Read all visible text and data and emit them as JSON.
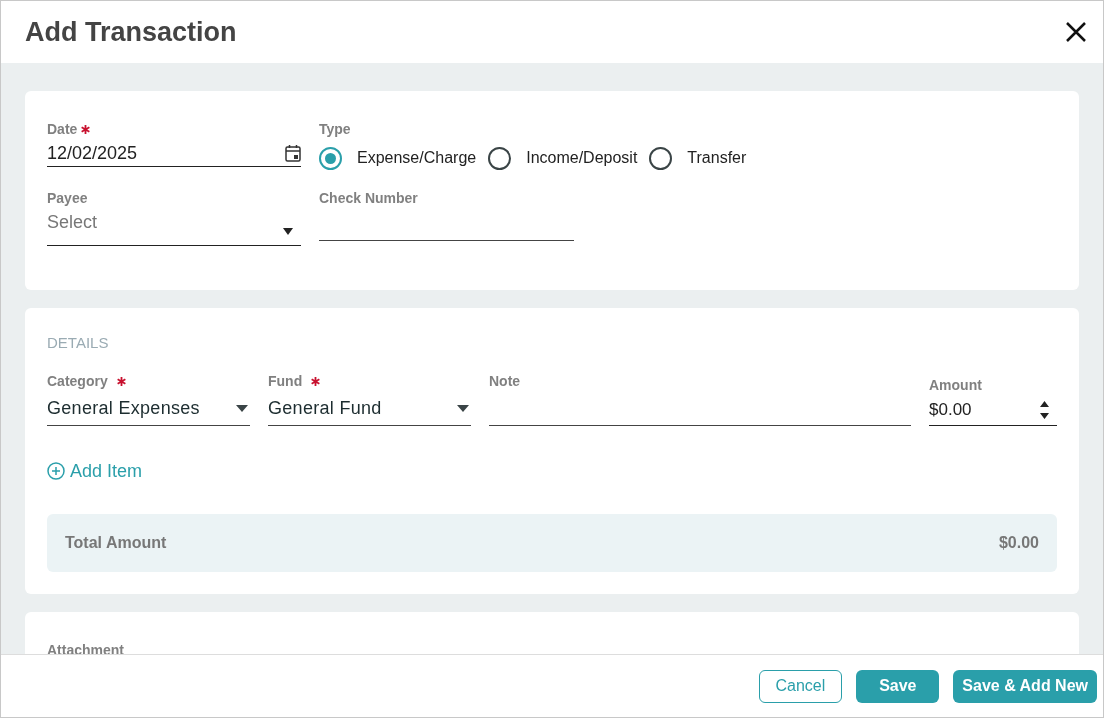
{
  "dialog": {
    "title": "Add Transaction"
  },
  "general": {
    "date": {
      "label": "Date",
      "required": true,
      "value": "12/02/2025"
    },
    "type": {
      "label": "Type",
      "options": [
        {
          "label": "Expense/Charge",
          "selected": true
        },
        {
          "label": "Income/Deposit",
          "selected": false
        },
        {
          "label": "Transfer",
          "selected": false
        }
      ]
    },
    "payee": {
      "label": "Payee",
      "placeholder": "Select"
    },
    "check_number": {
      "label": "Check Number"
    }
  },
  "details": {
    "heading": "DETAILS",
    "fields": [
      {
        "kind": "select",
        "label": "Category",
        "required": true,
        "value": "General Expenses"
      },
      {
        "kind": "select",
        "label": "Fund",
        "required": true,
        "value": "General Fund"
      },
      {
        "kind": "text",
        "label": "Note",
        "required": false
      },
      {
        "kind": "number",
        "label": "Amount",
        "required": false,
        "value": "$0.00"
      }
    ],
    "add_item": "Add Item",
    "total": {
      "label": "Total Amount",
      "value": "$0.00"
    }
  },
  "attachment": {
    "label": "Attachment"
  },
  "buttons": [
    {
      "kind": "outline",
      "label": "Cancel"
    },
    {
      "kind": "primary",
      "label": "Save"
    },
    {
      "kind": "primary",
      "label": "Save & Add New"
    }
  ]
}
